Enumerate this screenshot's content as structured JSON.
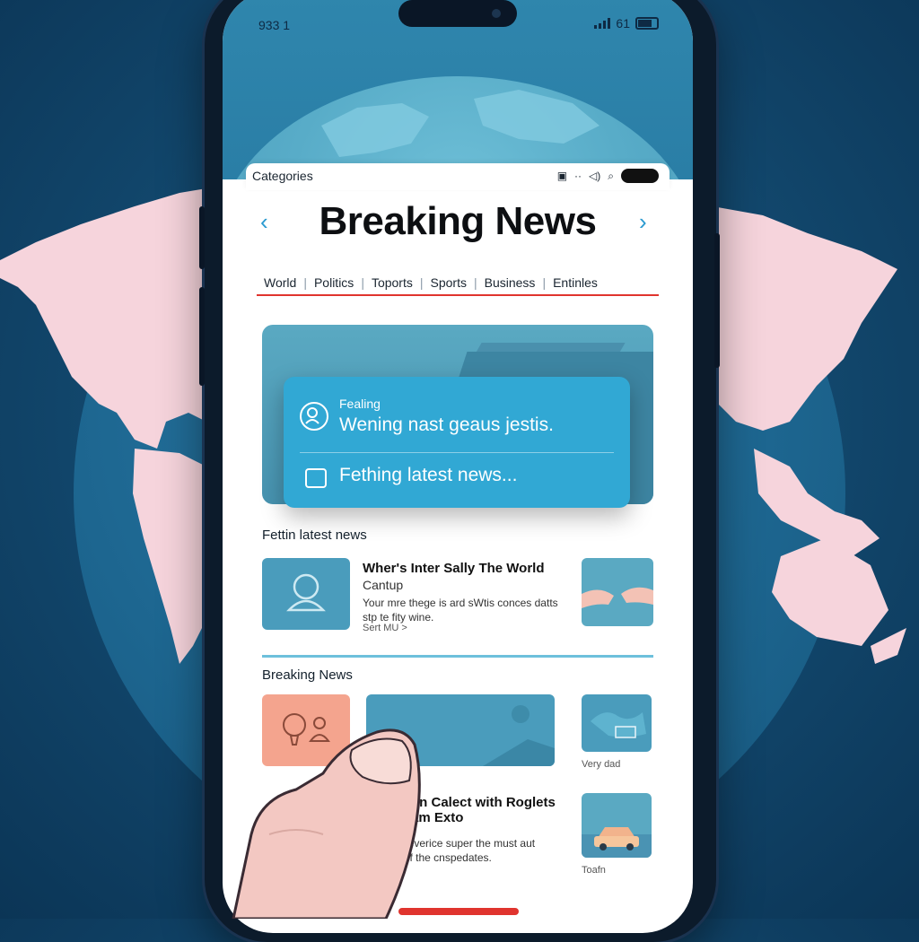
{
  "status_bar": {
    "time": "933 1",
    "signal_text": "61"
  },
  "top_bar": {
    "label": "Categories",
    "icons": [
      "lock-icon",
      "dots-icon",
      "sound-icon",
      "search-icon",
      "toggle-icon"
    ]
  },
  "header": {
    "title": "Breaking News",
    "prev_icon": "chevron-left-icon",
    "next_icon": "chevron-right-icon"
  },
  "tabs": [
    "World",
    "Politics",
    "Toports",
    "Sports",
    "Business",
    "Entinles"
  ],
  "feature": {
    "kicker": "Fealing",
    "title": "Wening nast geaus jestis.",
    "status": "Fething latest news..."
  },
  "latest": {
    "section_title": "Fettin latest news",
    "article": {
      "title": "Wher's Inter Sally The World",
      "subtitle": "Cantup",
      "body_line1": "Your mre thege is ard sWtis conces datts",
      "body_line2": "stp te fity wine.",
      "more": "Sert MU >"
    }
  },
  "breaking": {
    "section_title": "Breaking News",
    "caption_1": "Very dad",
    "article": {
      "title_line1": "on Calect with Roglets",
      "title_line2": "am Exto",
      "body_line1": "unfor everice super the must aut",
      "body_line2": "p st off the cnspedates.",
      "more": "ce"
    },
    "caption_2": "Toafn"
  },
  "colors": {
    "accent_red": "#e0342e",
    "card_blue": "#31a8d4",
    "background_navy": "#134a70",
    "map_pink": "#f6d4dc"
  }
}
